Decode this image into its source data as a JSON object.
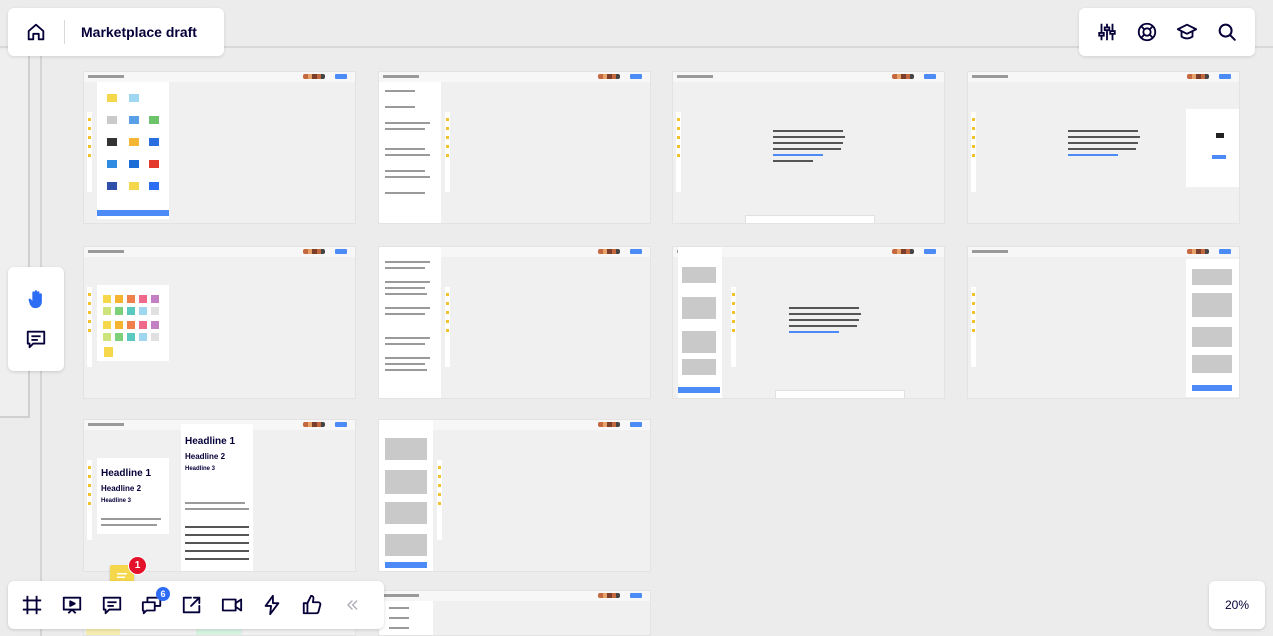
{
  "header": {
    "board_title": "Marketplace draft",
    "home_icon": "home-icon"
  },
  "top_right_toolbar": {
    "items": [
      {
        "name": "settings-sliders-icon"
      },
      {
        "name": "help-lifebuoy-icon"
      },
      {
        "name": "learning-cap-icon"
      },
      {
        "name": "search-icon"
      }
    ]
  },
  "left_toolbar": {
    "items": [
      {
        "name": "hand-tool-icon",
        "active": true
      },
      {
        "name": "comment-tool-icon",
        "active": false
      }
    ]
  },
  "bottom_toolbar": {
    "items": [
      {
        "name": "frames-icon"
      },
      {
        "name": "presentation-icon"
      },
      {
        "name": "comments-icon"
      },
      {
        "name": "chat-icon",
        "badge": "6"
      },
      {
        "name": "share-screen-icon"
      },
      {
        "name": "video-call-icon"
      },
      {
        "name": "activity-icon"
      },
      {
        "name": "vote-icon"
      },
      {
        "name": "collapse-icon"
      }
    ]
  },
  "zoom": {
    "level": "20%"
  },
  "comment_marker": {
    "count": "1"
  },
  "thumbnail_text": {
    "headline1": "Headline 1",
    "headline2": "Headline 2",
    "headline3": "Headline 3"
  },
  "colors": {
    "accent": "#2d6cf5",
    "badge_red": "#e3112a",
    "sticky_yellow": "#f5d74b"
  }
}
